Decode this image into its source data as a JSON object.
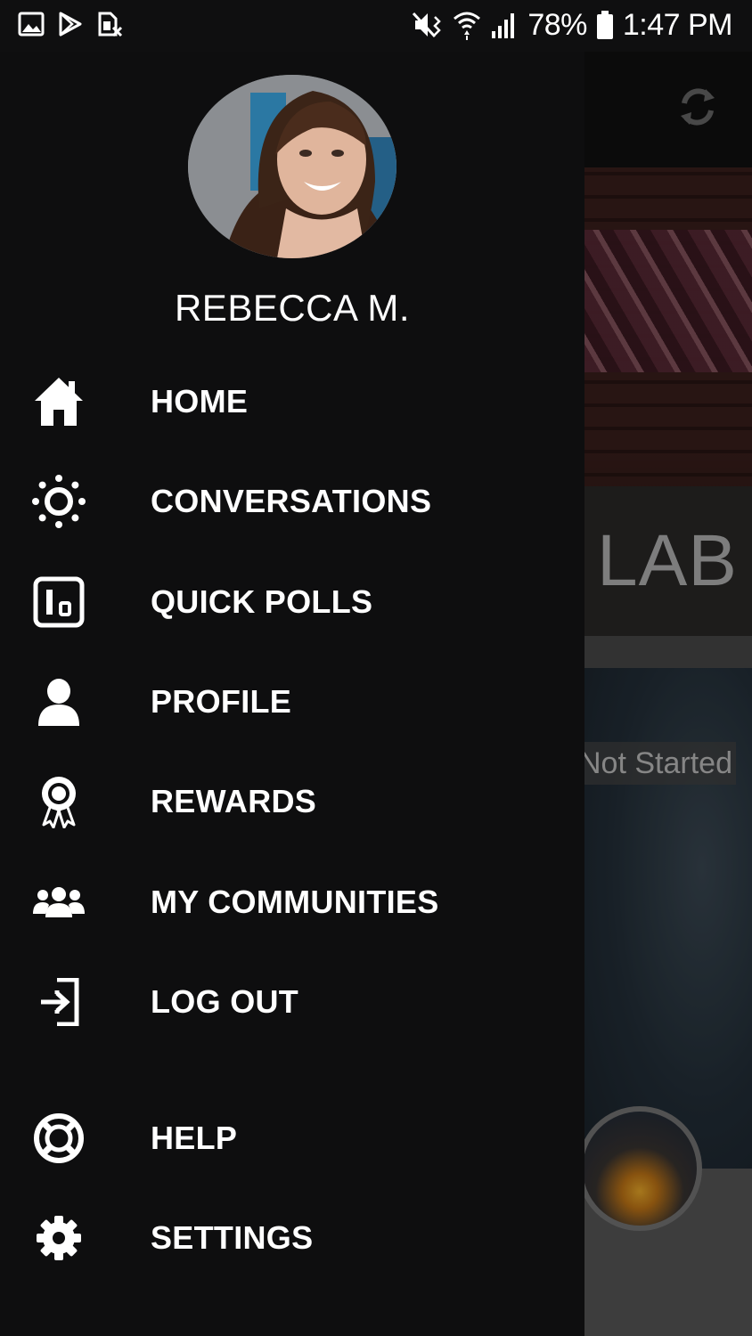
{
  "status_bar": {
    "left_icons": [
      "gallery-icon",
      "play-store-icon",
      "sim-off-icon"
    ],
    "right_icons": [
      "mute-icon",
      "wifi-icon",
      "signal-icon",
      "battery-icon"
    ],
    "battery": "78%",
    "time": "1:47 PM"
  },
  "drawer": {
    "user": {
      "name": "REBECCA M."
    },
    "items": [
      {
        "label": "HOME",
        "icon": "home-icon"
      },
      {
        "label": "CONVERSATIONS",
        "icon": "sun-icon"
      },
      {
        "label": "QUICK POLLS",
        "icon": "poll-icon"
      },
      {
        "label": "PROFILE",
        "icon": "person-icon"
      },
      {
        "label": "REWARDS",
        "icon": "award-ribbon-icon"
      },
      {
        "label": "MY COMMUNITIES",
        "icon": "group-icon"
      },
      {
        "label": "LOG OUT",
        "icon": "logout-icon"
      },
      {
        "label": "HELP",
        "icon": "lifebuoy-icon"
      },
      {
        "label": "SETTINGS",
        "icon": "gear-icon"
      }
    ]
  },
  "background_app": {
    "banner_text": "LAB",
    "status_text": "Not Started",
    "refresh_icon": "sync-icon"
  },
  "colors": {
    "drawer_bg": "#0e0e0f",
    "text": "#ffffff"
  }
}
